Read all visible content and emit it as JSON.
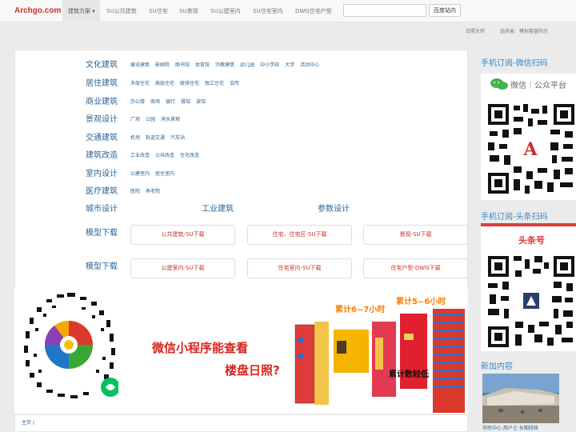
{
  "nav": {
    "logo": "Archgo.com",
    "items": [
      "建筑方案",
      "SU公共建筑",
      "SU住宅",
      "SU景观",
      "SU公建室内",
      "SU住宅室内",
      "DWG住宅户型"
    ],
    "search_button": "百度站内",
    "sub_links": [
      "日照大师",
      "选房易：模拟楼盘阳光"
    ]
  },
  "categories": [
    {
      "title": "文化建筑",
      "links": [
        "展览建筑",
        "影剧院",
        "图书馆",
        "体育馆",
        "宗教建筑",
        "幼儿园",
        "中小学校",
        "大学",
        "活动中心"
      ]
    },
    {
      "title": "居住建筑",
      "links": [
        "多层住宅",
        "高层住宅",
        "联排住宅",
        "独立住宅",
        "会所"
      ]
    },
    {
      "title": "商业建筑",
      "links": [
        "办公楼",
        "商场",
        "银行",
        "餐馆",
        "旅馆"
      ]
    },
    {
      "title": "景观设计",
      "links": [
        "广场",
        "公园",
        "滨水景观"
      ]
    },
    {
      "title": "交通建筑",
      "links": [
        "机场",
        "轨道交通",
        "汽车站"
      ]
    },
    {
      "title": "建筑改造",
      "links": [
        "工业改造",
        "公共改造",
        "住宅改造"
      ]
    },
    {
      "title": "室内设计",
      "links": [
        "公建室内",
        "居住室内"
      ]
    },
    {
      "title": "医疗建筑",
      "links": [
        "医院",
        "养老院"
      ]
    }
  ],
  "headers": [
    "城市设计",
    "工业建筑",
    "参数设计"
  ],
  "model_label": "模型下载",
  "downloads_row1": [
    "公共建筑-SU下载",
    "住宅、住宅区-SU下载",
    "景观-SU下载"
  ],
  "downloads_row2": [
    "公建室内-SU下载",
    "住宅室内-SU下载",
    "住宅户型-DWG下载"
  ],
  "banner": {
    "line1": "微信小程序能查看",
    "line2": "楼盘日照?",
    "tag1": "累计6~7小时",
    "tag2": "累计5~6小时",
    "tag3": "累计数较低"
  },
  "breadcrumb": "主页 /",
  "side": {
    "wechat_title": "手机订阅-微信扫码",
    "wechat_label": "微信｜公众平台",
    "toutiao_title": "手机订阅-头条扫码",
    "toutiao_label": "头条号",
    "recent_title": "新加内容",
    "recent_caption": "市民中心 用户七 长期持续"
  },
  "colors": {
    "accent": "#c9302c",
    "link": "#2a6496",
    "side_title": "#3a87c8"
  }
}
